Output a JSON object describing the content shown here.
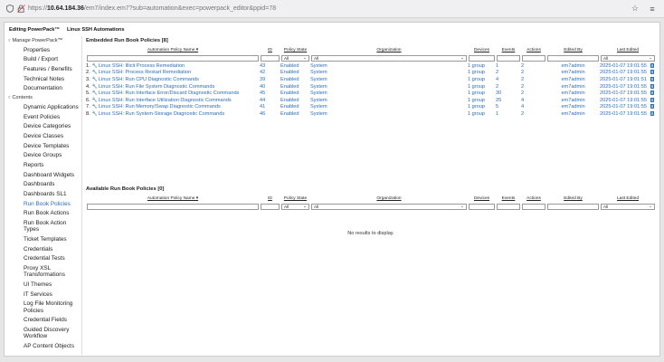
{
  "browser": {
    "url_prefix": "https://",
    "url_host": "10.64.184.36",
    "url_path": "/em7/index.em7?sub=automation&exec=powerpack_editor&ppid=78"
  },
  "page": {
    "title_prefix": "Editing PowerPack™",
    "title_name": "Linux SSH Automations"
  },
  "sidebar": {
    "manage_label": "Manage PowerPack™",
    "manage_items": [
      "Properties",
      "Build / Export",
      "Features / Benefits",
      "Technical Notes",
      "Documentation"
    ],
    "contents_label": "Contents",
    "contents_items": [
      "Dynamic Applications",
      "Event Policies",
      "Device Categories",
      "Device Classes",
      "Device Templates",
      "Device Groups",
      "Reports",
      "Dashboard Widgets",
      "Dashboards",
      "Dashboards SL1",
      "Run Book Policies",
      "Run Book Actions",
      "Run Book Action Types",
      "Ticket Templates",
      "Credentials",
      "Credential Tests",
      "Proxy XSL Transformations",
      "UI Themes",
      "IT Services",
      "Log File Monitoring Policies",
      "Credential Fields",
      "Guided Discovery Workflow",
      "AP Content Objects"
    ],
    "active_item": "Run Book Policies"
  },
  "embedded": {
    "heading": "Embedded Run Book Policies [8]",
    "columns": [
      "Automation Policy Name ▾",
      "ID",
      "Policy State",
      "Organization",
      "Devices",
      "Events",
      "Actions",
      "Edited By",
      "Last Edited"
    ],
    "filter_all": "All",
    "rows": [
      {
        "n": "1.",
        "name": "Linux SSH: Illicit Process Remediation",
        "id": "43",
        "state": "Enabled",
        "org": "System",
        "devices": "1 group",
        "events": "1",
        "actions": "2",
        "editor": "em7admin",
        "edited": "2025-01-07 19:01:55"
      },
      {
        "n": "2.",
        "name": "Linux SSH: Process Restart Remediation",
        "id": "42",
        "state": "Enabled",
        "org": "System",
        "devices": "1 group",
        "events": "2",
        "actions": "2",
        "editor": "em7admin",
        "edited": "2025-01-07 19:01:55"
      },
      {
        "n": "3.",
        "name": "Linux SSH: Run CPU Diagnostic Commands",
        "id": "39",
        "state": "Enabled",
        "org": "System",
        "devices": "1 group",
        "events": "4",
        "actions": "2",
        "editor": "em7admin",
        "edited": "2025-01-07 19:01:51"
      },
      {
        "n": "4.",
        "name": "Linux SSH: Run File System Diagnostic Commands",
        "id": "40",
        "state": "Enabled",
        "org": "System",
        "devices": "1 group",
        "events": "2",
        "actions": "2",
        "editor": "em7admin",
        "edited": "2025-01-07 19:01:55"
      },
      {
        "n": "5.",
        "name": "Linux SSH: Run Interface Error/Discard Diagnostic Commands",
        "id": "45",
        "state": "Enabled",
        "org": "System",
        "devices": "1 group",
        "events": "30",
        "actions": "2",
        "editor": "em7admin",
        "edited": "2025-01-07 19:01:55"
      },
      {
        "n": "6.",
        "name": "Linux SSH: Run Interface Utilization Diagnostic Commands",
        "id": "44",
        "state": "Enabled",
        "org": "System",
        "devices": "1 group",
        "events": "25",
        "actions": "4",
        "editor": "em7admin",
        "edited": "2025-01-07 19:01:55"
      },
      {
        "n": "7.",
        "name": "Linux SSH: Run Memory/Swap Diagnostic Commands",
        "id": "41",
        "state": "Enabled",
        "org": "System",
        "devices": "1 group",
        "events": "5",
        "actions": "4",
        "editor": "em7admin",
        "edited": "2025-01-07 19:01:55"
      },
      {
        "n": "8.",
        "name": "Linux SSH: Run System-Storage Diagnostic Commands",
        "id": "46",
        "state": "Enabled",
        "org": "System",
        "devices": "1 group",
        "events": "1",
        "actions": "2",
        "editor": "em7admin",
        "edited": "2025-01-07 19:01:55"
      }
    ]
  },
  "available": {
    "heading": "Available Run Book Policies [0]",
    "columns": [
      "Automation Policy Name ▾",
      "ID",
      "Policy State",
      "Organization",
      "Devices",
      "Events",
      "Actions",
      "Edited By",
      "Last Edited"
    ],
    "filter_all": "All",
    "empty_text": "No results to display."
  },
  "colors": {
    "link": "#2a6ebb"
  }
}
